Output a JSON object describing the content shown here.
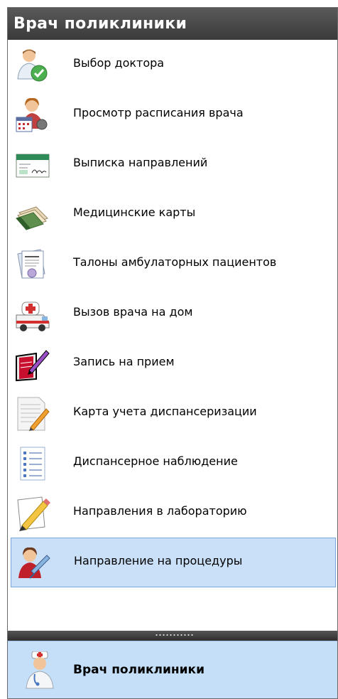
{
  "header": {
    "title": "Врач поликлиники"
  },
  "menu": {
    "items": [
      {
        "label": "Выбор доктора",
        "icon": "doctor-check-icon"
      },
      {
        "label": "Просмотр расписания врача",
        "icon": "doctor-calendar-icon"
      },
      {
        "label": "Выписка направлений",
        "icon": "referral-form-icon"
      },
      {
        "label": "Медицинские карты",
        "icon": "medical-cards-icon"
      },
      {
        "label": "Талоны амбулаторных пациентов",
        "icon": "coupon-document-icon"
      },
      {
        "label": "Вызов врача на дом",
        "icon": "ambulance-icon"
      },
      {
        "label": "Запись на прием",
        "icon": "appointment-book-icon"
      },
      {
        "label": "Карта учета диспансеризации",
        "icon": "checkup-card-icon"
      },
      {
        "label": "Диспансерное наблюдение",
        "icon": "checklist-icon"
      },
      {
        "label": "Направления в лабораторию",
        "icon": "lab-referral-icon"
      },
      {
        "label": "Направление на процедуры",
        "icon": "procedure-icon",
        "selected": true
      }
    ]
  },
  "navigation": {
    "active_button": "Врач поликлиники",
    "icon": "doctor-icon"
  },
  "colors": {
    "header": "#444444",
    "selected": "#c9e0f8",
    "nav_button": "#c5dff8"
  }
}
